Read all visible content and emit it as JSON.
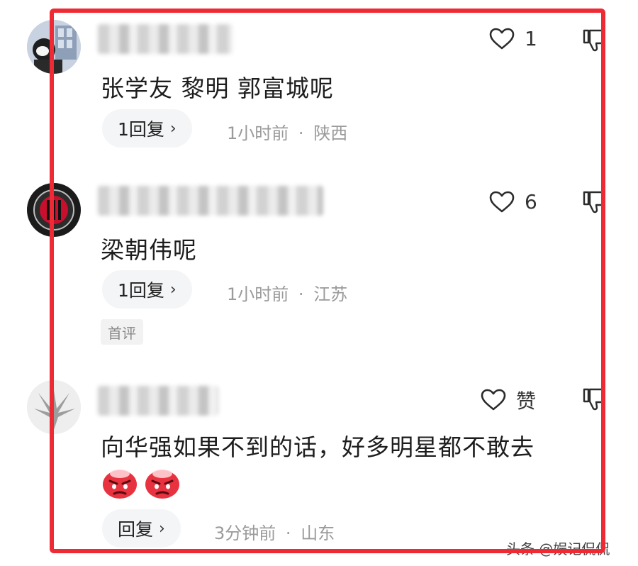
{
  "comments": [
    {
      "text": "张学友 黎明 郭富城呢",
      "like_count": "1",
      "reply_label": "1回复",
      "time": "1小时前",
      "separator": "·",
      "location": "陕西",
      "tag": ""
    },
    {
      "text": "梁朝伟呢",
      "like_count": "6",
      "reply_label": "1回复",
      "time": "1小时前",
      "separator": "·",
      "location": "江苏",
      "tag": "首评"
    },
    {
      "text": "向华强如果不到的话，好多明星都不敢去",
      "like_count": "赞",
      "reply_label": "回复",
      "time": "3分钟前",
      "separator": "·",
      "location": "山东",
      "tag": ""
    }
  ],
  "reply_chevron": "›",
  "watermark": "头条 @娱记侃侃",
  "colors": {
    "highlight_frame": "#ee2b34",
    "pill_bg": "#f4f5f7",
    "meta_text": "#9a9a9a"
  },
  "icons": {
    "like": "heart-outline-icon",
    "dislike": "thumbs-down-icon",
    "emoji": "angry-face-emoji"
  }
}
